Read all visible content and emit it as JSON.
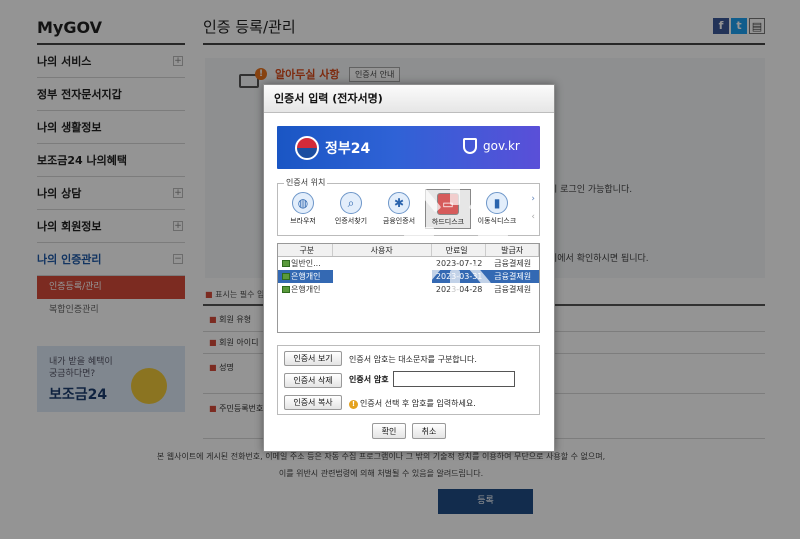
{
  "sidebar": {
    "brand": "MyGOV",
    "items": [
      {
        "label": "나의 서비스",
        "expand": "+"
      },
      {
        "label": "정부 전자문서지갑",
        "expand": ""
      },
      {
        "label": "나의 생활정보",
        "expand": ""
      },
      {
        "label": "보조금24 나의혜택",
        "expand": ""
      },
      {
        "label": "나의 상담",
        "expand": "+"
      },
      {
        "label": "나의 회원정보",
        "expand": "+"
      },
      {
        "label": "나의 인증관리",
        "expand": "−"
      }
    ],
    "submenu": [
      "인증등록/관리",
      "복합인증관리"
    ],
    "banner": {
      "line1": "내가 받을 혜택이",
      "line2": "궁금하다면?",
      "title": "보조금24"
    }
  },
  "main": {
    "title": "인증 등록/관리",
    "notice_title": "알아두실 사항",
    "notice_button": "인증서 안내",
    "bg_line1": "시 로그인 가능합니다.",
    "bg_line2": "지에서 확인하시면 됩니다.",
    "required_note": "표시는 필수 입",
    "form_labels": [
      "회원 유형",
      "회원 아이디",
      "성명",
      "주민등록번호"
    ],
    "footer_line1": "본 웹사이트에 게시된 전화번호, 이메일 주소 등은 자동 수집 프로그램이나 그 밖의 기술적 장치를 이용하여 무단으로 사용할 수 없으며,",
    "footer_line2": "이를 위반시 관련법령에 의해 처벌될 수 있음을 알려드립니다.",
    "submit_label": "등록"
  },
  "dialog": {
    "title": "인증서 입력 (전자서명)",
    "gov_name": "정부24",
    "gov_url": "gov.kr",
    "location_legend": "인증서 위치",
    "locations": [
      {
        "label": "브라우저",
        "icon": "browser-icon"
      },
      {
        "label": "인증서찾기",
        "icon": "search-icon"
      },
      {
        "label": "금융인증서",
        "icon": "finance-cert-icon"
      },
      {
        "label": "하드디스크",
        "icon": "harddisk-icon"
      },
      {
        "label": "이동식디스크",
        "icon": "usb-icon"
      }
    ],
    "table_headers": [
      "구분",
      "사용자",
      "만료일",
      "발급자"
    ],
    "certs": [
      {
        "type": "일반인...",
        "user": "",
        "expiry": "2023-07-12",
        "issuer": "금융결제원"
      },
      {
        "type": "은행개인",
        "user": "",
        "expiry": "2023-03-31",
        "issuer": "금융결제원"
      },
      {
        "type": "은행개인",
        "user": "",
        "expiry": "2023-04-28",
        "issuer": "금융결제원"
      }
    ],
    "selected_cert": 1,
    "view_button": "인증서 보기",
    "delete_button": "인증서 삭제",
    "copy_button": "인증서 복사",
    "case_note": "인증서 암호는 대소문자를 구분합니다.",
    "password_label": "인증서 암호",
    "password_value": "",
    "hint": "인증서 선택 후 암호를 입력하세요.",
    "confirm_button": "확인",
    "cancel_button": "취소"
  }
}
